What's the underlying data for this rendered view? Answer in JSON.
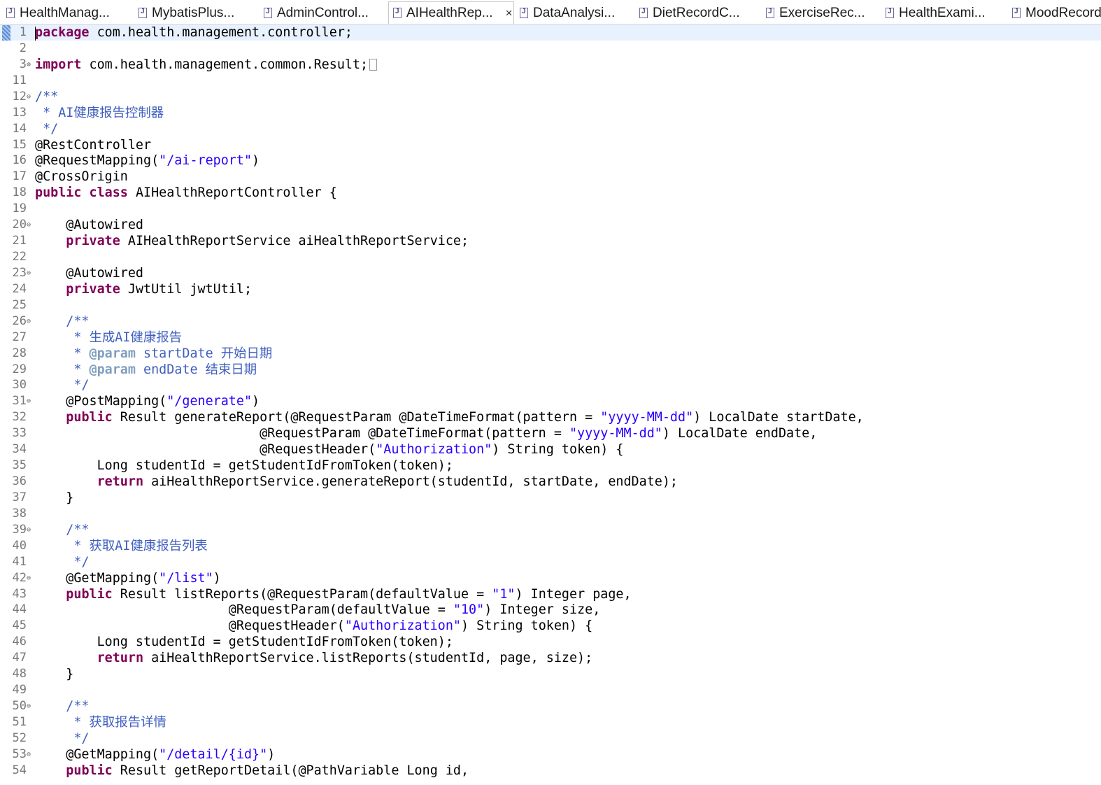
{
  "tabs": [
    {
      "label": "HealthManag...",
      "active": false
    },
    {
      "label": "MybatisPlus...",
      "active": false
    },
    {
      "label": "AdminControl...",
      "active": false
    },
    {
      "label": "AIHealthRep...",
      "active": true,
      "close": "×"
    },
    {
      "label": "DataAnalysi...",
      "active": false
    },
    {
      "label": "DietRecordC...",
      "active": false
    },
    {
      "label": "ExerciseRec...",
      "active": false
    },
    {
      "label": "HealthExami...",
      "active": false
    },
    {
      "label": "MoodRecord",
      "active": false
    }
  ],
  "lines": [
    {
      "n": "1",
      "fold": "",
      "tokens": [
        {
          "t": "package",
          "c": "kw"
        },
        {
          "t": " com.health.management.controller;",
          "c": ""
        }
      ]
    },
    {
      "n": "2",
      "fold": "",
      "tokens": []
    },
    {
      "n": "3",
      "fold": "⊕",
      "tokens": [
        {
          "t": "import",
          "c": "kw"
        },
        {
          "t": " com.health.management.common.Result;",
          "c": ""
        }
      ],
      "collapsed": true
    },
    {
      "n": "11",
      "fold": "",
      "tokens": []
    },
    {
      "n": "12",
      "fold": "⊖",
      "tokens": [
        {
          "t": "/**",
          "c": "cm"
        }
      ]
    },
    {
      "n": "13",
      "fold": "",
      "tokens": [
        {
          "t": " * AI健康报告控制器",
          "c": "cm"
        }
      ]
    },
    {
      "n": "14",
      "fold": "",
      "tokens": [
        {
          "t": " */",
          "c": "cm"
        }
      ]
    },
    {
      "n": "15",
      "fold": "",
      "tokens": [
        {
          "t": "@RestController",
          "c": ""
        }
      ]
    },
    {
      "n": "16",
      "fold": "",
      "tokens": [
        {
          "t": "@RequestMapping(",
          "c": ""
        },
        {
          "t": "\"/ai-report\"",
          "c": "str"
        },
        {
          "t": ")",
          "c": ""
        }
      ]
    },
    {
      "n": "17",
      "fold": "",
      "tokens": [
        {
          "t": "@CrossOrigin",
          "c": ""
        }
      ]
    },
    {
      "n": "18",
      "fold": "",
      "tokens": [
        {
          "t": "public",
          "c": "kw"
        },
        {
          "t": " ",
          "c": ""
        },
        {
          "t": "class",
          "c": "kw"
        },
        {
          "t": " AIHealthReportController {",
          "c": ""
        }
      ]
    },
    {
      "n": "19",
      "fold": "",
      "tokens": []
    },
    {
      "n": "20",
      "fold": "⊖",
      "tokens": [
        {
          "t": "    @Autowired",
          "c": ""
        }
      ]
    },
    {
      "n": "21",
      "fold": "",
      "tokens": [
        {
          "t": "    ",
          "c": ""
        },
        {
          "t": "private",
          "c": "kw"
        },
        {
          "t": " AIHealthReportService aiHealthReportService;",
          "c": ""
        }
      ]
    },
    {
      "n": "22",
      "fold": "",
      "tokens": []
    },
    {
      "n": "23",
      "fold": "⊖",
      "tokens": [
        {
          "t": "    @Autowired",
          "c": ""
        }
      ]
    },
    {
      "n": "24",
      "fold": "",
      "tokens": [
        {
          "t": "    ",
          "c": ""
        },
        {
          "t": "private",
          "c": "kw"
        },
        {
          "t": " JwtUtil jwtUtil;",
          "c": ""
        }
      ]
    },
    {
      "n": "25",
      "fold": "",
      "tokens": []
    },
    {
      "n": "26",
      "fold": "⊖",
      "tokens": [
        {
          "t": "    /**",
          "c": "cm"
        }
      ]
    },
    {
      "n": "27",
      "fold": "",
      "tokens": [
        {
          "t": "     * 生成AI健康报告",
          "c": "cm"
        }
      ]
    },
    {
      "n": "28",
      "fold": "",
      "tokens": [
        {
          "t": "     * ",
          "c": "cm"
        },
        {
          "t": "@param",
          "c": "tag"
        },
        {
          "t": " startDate 开始日期",
          "c": "cm"
        }
      ]
    },
    {
      "n": "29",
      "fold": "",
      "tokens": [
        {
          "t": "     * ",
          "c": "cm"
        },
        {
          "t": "@param",
          "c": "tag"
        },
        {
          "t": " endDate 结束日期",
          "c": "cm"
        }
      ]
    },
    {
      "n": "30",
      "fold": "",
      "tokens": [
        {
          "t": "     */",
          "c": "cm"
        }
      ]
    },
    {
      "n": "31",
      "fold": "⊖",
      "tokens": [
        {
          "t": "    @PostMapping(",
          "c": ""
        },
        {
          "t": "\"/generate\"",
          "c": "str"
        },
        {
          "t": ")",
          "c": ""
        }
      ]
    },
    {
      "n": "32",
      "fold": "",
      "tokens": [
        {
          "t": "    ",
          "c": ""
        },
        {
          "t": "public",
          "c": "kw"
        },
        {
          "t": " Result generateReport(@RequestParam @DateTimeFormat(pattern = ",
          "c": ""
        },
        {
          "t": "\"yyyy-MM-dd\"",
          "c": "str"
        },
        {
          "t": ") LocalDate startDate,",
          "c": ""
        }
      ]
    },
    {
      "n": "33",
      "fold": "",
      "tokens": [
        {
          "t": "                             @RequestParam @DateTimeFormat(pattern = ",
          "c": ""
        },
        {
          "t": "\"yyyy-MM-dd\"",
          "c": "str"
        },
        {
          "t": ") LocalDate endDate,",
          "c": ""
        }
      ]
    },
    {
      "n": "34",
      "fold": "",
      "tokens": [
        {
          "t": "                             @RequestHeader(",
          "c": ""
        },
        {
          "t": "\"Authorization\"",
          "c": "str"
        },
        {
          "t": ") String token) {",
          "c": ""
        }
      ]
    },
    {
      "n": "35",
      "fold": "",
      "tokens": [
        {
          "t": "        Long studentId = getStudentIdFromToken(token);",
          "c": ""
        }
      ]
    },
    {
      "n": "36",
      "fold": "",
      "tokens": [
        {
          "t": "        ",
          "c": ""
        },
        {
          "t": "return",
          "c": "kw"
        },
        {
          "t": " aiHealthReportService.generateReport(studentId, startDate, endDate);",
          "c": ""
        }
      ]
    },
    {
      "n": "37",
      "fold": "",
      "tokens": [
        {
          "t": "    }",
          "c": ""
        }
      ]
    },
    {
      "n": "38",
      "fold": "",
      "tokens": []
    },
    {
      "n": "39",
      "fold": "⊖",
      "tokens": [
        {
          "t": "    /**",
          "c": "cm"
        }
      ]
    },
    {
      "n": "40",
      "fold": "",
      "tokens": [
        {
          "t": "     * 获取AI健康报告列表",
          "c": "cm"
        }
      ]
    },
    {
      "n": "41",
      "fold": "",
      "tokens": [
        {
          "t": "     */",
          "c": "cm"
        }
      ]
    },
    {
      "n": "42",
      "fold": "⊖",
      "tokens": [
        {
          "t": "    @GetMapping(",
          "c": ""
        },
        {
          "t": "\"/list\"",
          "c": "str"
        },
        {
          "t": ")",
          "c": ""
        }
      ]
    },
    {
      "n": "43",
      "fold": "",
      "tokens": [
        {
          "t": "    ",
          "c": ""
        },
        {
          "t": "public",
          "c": "kw"
        },
        {
          "t": " Result listReports(@RequestParam(defaultValue = ",
          "c": ""
        },
        {
          "t": "\"1\"",
          "c": "str"
        },
        {
          "t": ") Integer page,",
          "c": ""
        }
      ]
    },
    {
      "n": "44",
      "fold": "",
      "tokens": [
        {
          "t": "                         @RequestParam(defaultValue = ",
          "c": ""
        },
        {
          "t": "\"10\"",
          "c": "str"
        },
        {
          "t": ") Integer size,",
          "c": ""
        }
      ]
    },
    {
      "n": "45",
      "fold": "",
      "tokens": [
        {
          "t": "                         @RequestHeader(",
          "c": ""
        },
        {
          "t": "\"Authorization\"",
          "c": "str"
        },
        {
          "t": ") String token) {",
          "c": ""
        }
      ]
    },
    {
      "n": "46",
      "fold": "",
      "tokens": [
        {
          "t": "        Long studentId = getStudentIdFromToken(token);",
          "c": ""
        }
      ]
    },
    {
      "n": "47",
      "fold": "",
      "tokens": [
        {
          "t": "        ",
          "c": ""
        },
        {
          "t": "return",
          "c": "kw"
        },
        {
          "t": " aiHealthReportService.listReports(studentId, page, size);",
          "c": ""
        }
      ]
    },
    {
      "n": "48",
      "fold": "",
      "tokens": [
        {
          "t": "    }",
          "c": ""
        }
      ]
    },
    {
      "n": "49",
      "fold": "",
      "tokens": []
    },
    {
      "n": "50",
      "fold": "⊖",
      "tokens": [
        {
          "t": "    /**",
          "c": "cm"
        }
      ]
    },
    {
      "n": "51",
      "fold": "",
      "tokens": [
        {
          "t": "     * 获取报告详情",
          "c": "cm"
        }
      ]
    },
    {
      "n": "52",
      "fold": "",
      "tokens": [
        {
          "t": "     */",
          "c": "cm"
        }
      ]
    },
    {
      "n": "53",
      "fold": "⊖",
      "tokens": [
        {
          "t": "    @GetMapping(",
          "c": ""
        },
        {
          "t": "\"/detail/{id}\"",
          "c": "str"
        },
        {
          "t": ")",
          "c": ""
        }
      ]
    },
    {
      "n": "54",
      "fold": "",
      "tokens": [
        {
          "t": "    ",
          "c": ""
        },
        {
          "t": "public",
          "c": "kw"
        },
        {
          "t": " Result getReportDetail(@PathVariable Long id,",
          "c": ""
        }
      ]
    }
  ]
}
